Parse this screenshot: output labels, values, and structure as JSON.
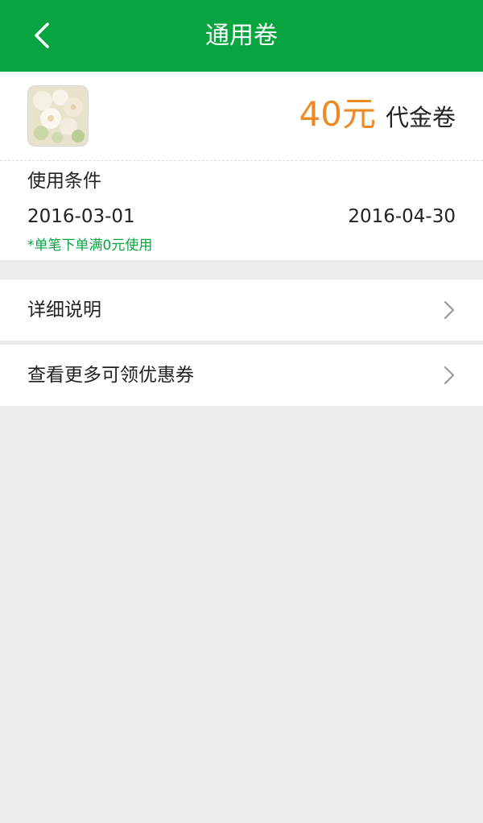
{
  "header": {
    "title": "通用卷",
    "back_icon": "back-arrow-icon"
  },
  "coupon": {
    "amount": "40元",
    "type": "代金卷",
    "condition_title": "使用条件",
    "start_date": "2016-03-01",
    "end_date": "2016-04-30",
    "note": "*单笔下单满0元使用"
  },
  "rows": [
    {
      "label": "详细说明"
    },
    {
      "label": "查看更多可领优惠券"
    }
  ],
  "colors": {
    "brand": "#08a440",
    "amount": "#ee8a26",
    "background": "#ededed"
  }
}
